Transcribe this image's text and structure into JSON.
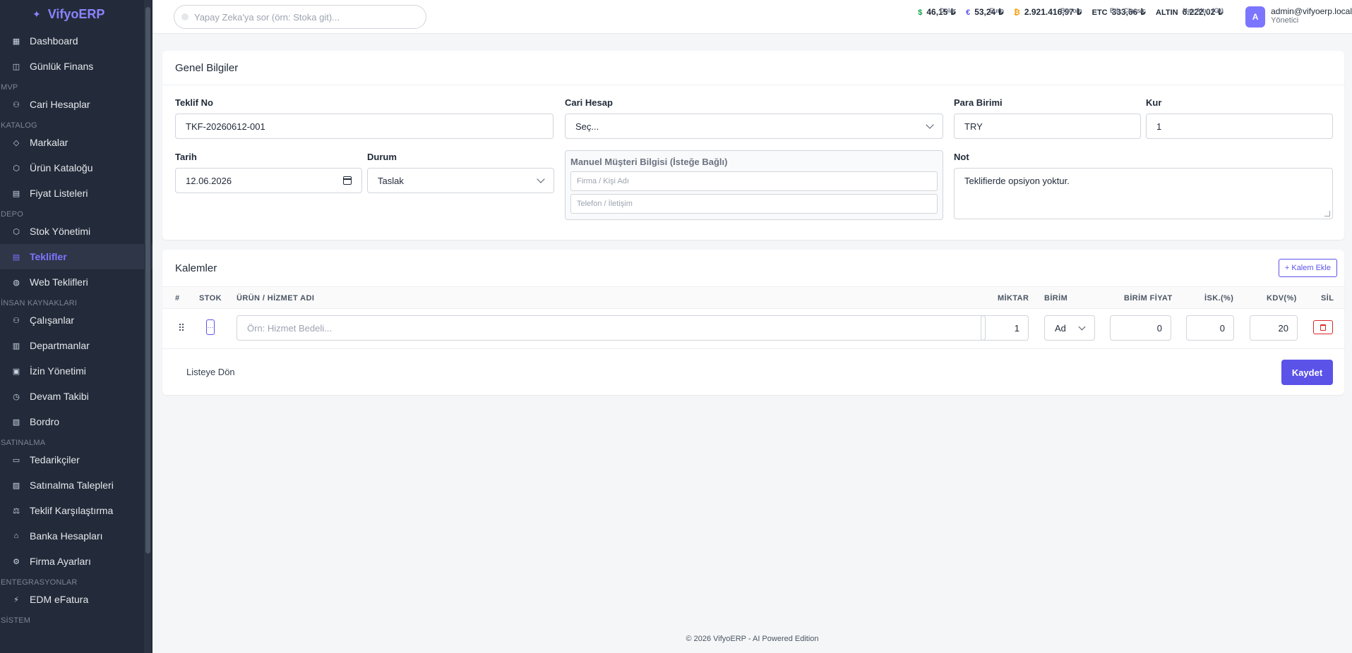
{
  "brand": {
    "name": "VifyoERP"
  },
  "sidebar": {
    "items": [
      {
        "type": "item",
        "label": "Dashboard",
        "icon": "dashboard-icon"
      },
      {
        "type": "item",
        "label": "Günlük Finans",
        "icon": "finance-icon"
      },
      {
        "type": "section",
        "label": "MVP"
      },
      {
        "type": "item",
        "label": "Cari Hesaplar",
        "icon": "users-icon"
      },
      {
        "type": "section",
        "label": "KATALOG"
      },
      {
        "type": "item",
        "label": "Markalar",
        "icon": "tag-icon"
      },
      {
        "type": "item",
        "label": "Ürün Kataloğu",
        "icon": "box-icon"
      },
      {
        "type": "item",
        "label": "Fiyat Listeleri",
        "icon": "document-icon"
      },
      {
        "type": "section",
        "label": "DEPO"
      },
      {
        "type": "item",
        "label": "Stok Yönetimi",
        "icon": "box-icon"
      },
      {
        "type": "item",
        "label": "Teklifler",
        "icon": "document-icon",
        "active": true
      },
      {
        "type": "item",
        "label": "Web Teklifleri",
        "icon": "globe-icon"
      },
      {
        "type": "section",
        "label": "İNSAN KAYNAKLARI"
      },
      {
        "type": "item",
        "label": "Çalışanlar",
        "icon": "users-icon"
      },
      {
        "type": "item",
        "label": "Departmanlar",
        "icon": "building-icon"
      },
      {
        "type": "item",
        "label": "İzin Yönetimi",
        "icon": "calendar-icon"
      },
      {
        "type": "item",
        "label": "Devam Takibi",
        "icon": "clock-icon"
      },
      {
        "type": "item",
        "label": "Bordro",
        "icon": "receipt-icon"
      },
      {
        "type": "section",
        "label": "SATINALMA"
      },
      {
        "type": "item",
        "label": "Tedarikçiler",
        "icon": "truck-icon"
      },
      {
        "type": "item",
        "label": "Satınalma Talepleri",
        "icon": "clipboard-icon"
      },
      {
        "type": "item",
        "label": "Teklif Karşılaştırma",
        "icon": "scale-icon"
      },
      {
        "type": "item",
        "label": "Banka Hesapları",
        "icon": "bank-icon"
      },
      {
        "type": "item",
        "label": "Firma Ayarları",
        "icon": "gear-icon"
      },
      {
        "type": "section",
        "label": "ENTEGRASYONLAR"
      },
      {
        "type": "item",
        "label": "EDM eFatura",
        "icon": "plug-icon"
      },
      {
        "type": "section",
        "label": "SİSTEM"
      }
    ]
  },
  "topbar": {
    "search_placeholder": "Yapay Zeka'ya sor (örn: Stoka git)...",
    "rates": [
      {
        "symbol": "$",
        "value": "46,15 ₺",
        "label": "Dolar",
        "color": "#16a34a"
      },
      {
        "symbol": "€",
        "value": "53,24 ₺",
        "label": "Euro",
        "color": "#5b52e8"
      },
      {
        "symbol": "₿",
        "value": "2.921.416,97 ₺",
        "label": "Bitcoin",
        "color": "#f59e0b"
      },
      {
        "symbol": "ETC",
        "value": "333,66 ₺",
        "label": "Eth. Classic",
        "color": "#1f2937"
      },
      {
        "symbol": "ALTIN",
        "value": "6.222,02 ₺",
        "label": "Has Altın (Gr)",
        "color": "#1f2937"
      }
    ],
    "user": {
      "avatar_letter": "A",
      "email": "admin@vifyoerp.local",
      "role": "Yönetici"
    }
  },
  "general": {
    "title": "Genel Bilgiler",
    "teklif_no_label": "Teklif No",
    "teklif_no_value": "TKF-20260612-001",
    "cari_label": "Cari Hesap",
    "cari_value": "Seç...",
    "para_label": "Para Birimi",
    "para_value": "TRY",
    "kur_label": "Kur",
    "kur_value": "1",
    "tarih_label": "Tarih",
    "tarih_value": "12.06.2026",
    "durum_label": "Durum",
    "durum_value": "Taslak",
    "manual_title": "Manuel Müşteri Bilgisi (İsteğe Bağlı)",
    "manual_name_placeholder": "Firma / Kişi Adı",
    "manual_phone_placeholder": "Telefon / İletişim",
    "not_label": "Not",
    "not_value": "Teklifierde opsiyon yoktur."
  },
  "items": {
    "title": "Kalemler",
    "add_label": "+ Kalem Ekle",
    "columns": [
      "#",
      "STOK",
      "ÜRÜN / HİZMET ADI",
      "MİKTAR",
      "BİRİM",
      "BİRİM FİYAT",
      "İSK.(%)",
      "KDV(%)",
      "SİL"
    ],
    "row": {
      "drag": "⠿",
      "stock": "···",
      "name_placeholder": "Örn: Hizmet Bedeli...",
      "qty": "1",
      "unit": "Ad",
      "price": "0",
      "discount": "0",
      "vat": "20"
    },
    "back_label": "Listeye Dön",
    "save_label": "Kaydet"
  },
  "footer": {
    "text": "© 2026 VifyoERP - AI Powered Edition"
  },
  "colors": {
    "accent": "#5b52e8",
    "sidebar_bg": "#232b3a",
    "danger": "#dc2626"
  }
}
